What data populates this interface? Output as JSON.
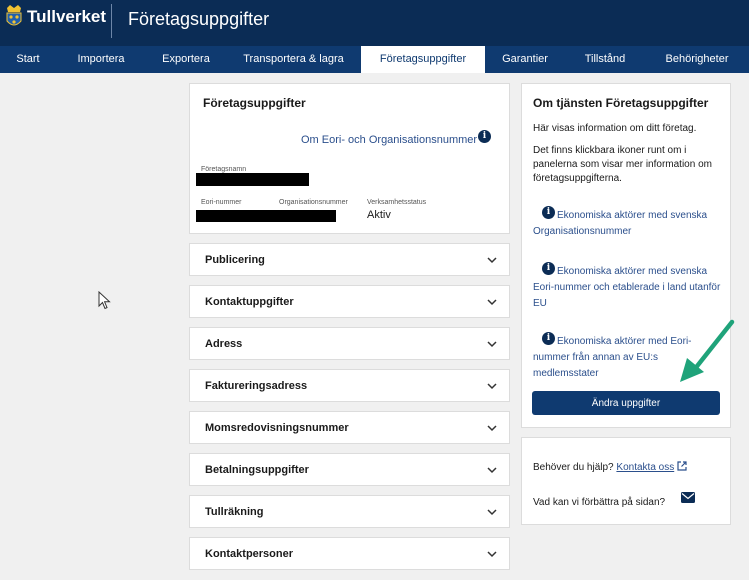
{
  "header": {
    "logo_text": "Tullverket",
    "app_title": "Företagsuppgifter"
  },
  "nav": {
    "items": [
      {
        "label": "Start"
      },
      {
        "label": "Importera"
      },
      {
        "label": "Exportera"
      },
      {
        "label": "Transportera & lagra"
      },
      {
        "label": "Företagsuppgifter"
      },
      {
        "label": "Garantier"
      },
      {
        "label": "Tillstånd"
      },
      {
        "label": "Behörigheter"
      }
    ],
    "active": "Företagsuppgifter"
  },
  "company": {
    "title": "Företagsuppgifter",
    "eori_link": "Om Eori- och Organisationsnummer",
    "name_label": "Företagsnamn",
    "eori_label": "Eori-nummer",
    "org_label": "Organisationsnummer",
    "status_label": "Verksamhetsstatus",
    "status_value": "Aktiv"
  },
  "sections": [
    {
      "label": "Publicering"
    },
    {
      "label": "Kontaktuppgifter"
    },
    {
      "label": "Adress"
    },
    {
      "label": "Faktureringsadress"
    },
    {
      "label": "Momsredovisningsnummer"
    },
    {
      "label": "Betalningsuppgifter"
    },
    {
      "label": "Tullräkning"
    },
    {
      "label": "Kontaktpersoner"
    }
  ],
  "about": {
    "title": "Om tjänsten Företagsuppgifter",
    "text1": "Här visas information om ditt företag.",
    "text2": "Det finns klickbara ikoner runt om i panelerna som visar mer information om företagsuppgifterna.",
    "links": [
      {
        "label": "Ekonomiska aktörer med svenska Organisationsnummer"
      },
      {
        "label": "Ekonomiska aktörer med svenska Eori-nummer och etablerade i land utanför EU"
      },
      {
        "label": "Ekonomiska aktörer med Eori-nummer från annan av EU:s medlemsstater"
      }
    ],
    "edit_button": "Ändra uppgifter"
  },
  "help": {
    "question": "Behöver du hjälp?",
    "contact_link": "Kontakta oss",
    "feedback": "Vad kan vi förbättra på sidan?"
  },
  "colors": {
    "header_bg": "#0b2c55",
    "nav_bg": "#0f3a70",
    "link": "#2b4f8c",
    "annotation_arrow": "#1fa37a"
  },
  "icons": {
    "info": "info-icon",
    "chevron": "chevron-down-icon",
    "external": "external-link-icon",
    "mail": "mail-icon",
    "cursor": "mouse-pointer-icon"
  }
}
